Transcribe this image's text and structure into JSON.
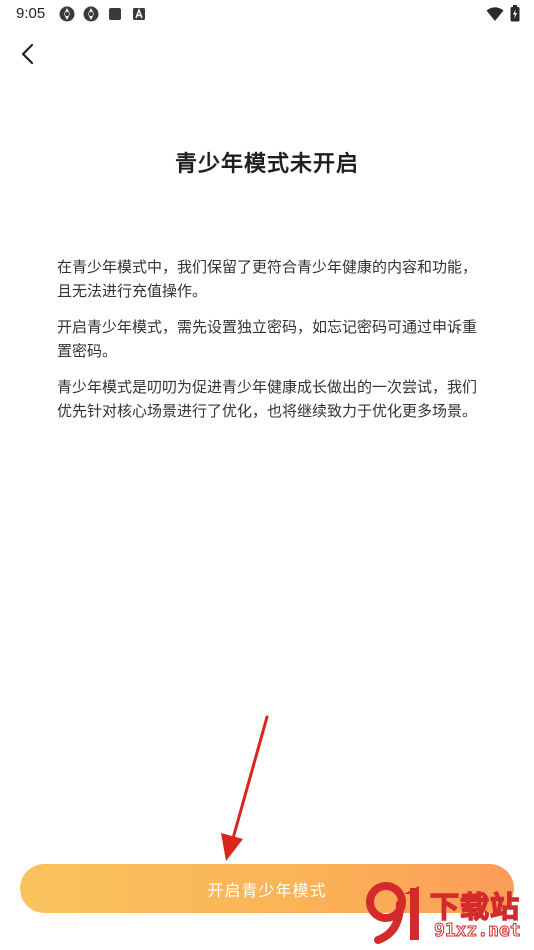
{
  "status_bar": {
    "time": "9:05",
    "left_icons": [
      "shield-sync-icon",
      "shield-sync-icon",
      "stop-square-icon",
      "app-a-icon"
    ],
    "right_icons": [
      "wifi-icon",
      "battery-charging-icon"
    ]
  },
  "header": {
    "back_icon": "chevron-left-icon"
  },
  "main": {
    "title": "青少年模式未开启",
    "paragraphs": [
      "在青少年模式中，我们保留了更符合青少年健康的内容和功能，且无法进行充值操作。",
      "开启青少年模式，需先设置独立密码，如忘记密码可通过申诉重置密码。",
      "青少年模式是叨叨为促进青少年健康成长做出的一次尝试，我们优先针对核心场景进行了优化，也将继续致力于优化更多场景。"
    ]
  },
  "footer": {
    "enable_button_label": "开启青少年模式"
  },
  "watermark": {
    "title": "下载站",
    "domain": "91xz.net"
  },
  "colors": {
    "button_gradient_start": "#f9c35c",
    "button_gradient_end": "#fb9c58",
    "annotation_arrow": "#d9261c",
    "watermark_red": "#d32b2b"
  }
}
